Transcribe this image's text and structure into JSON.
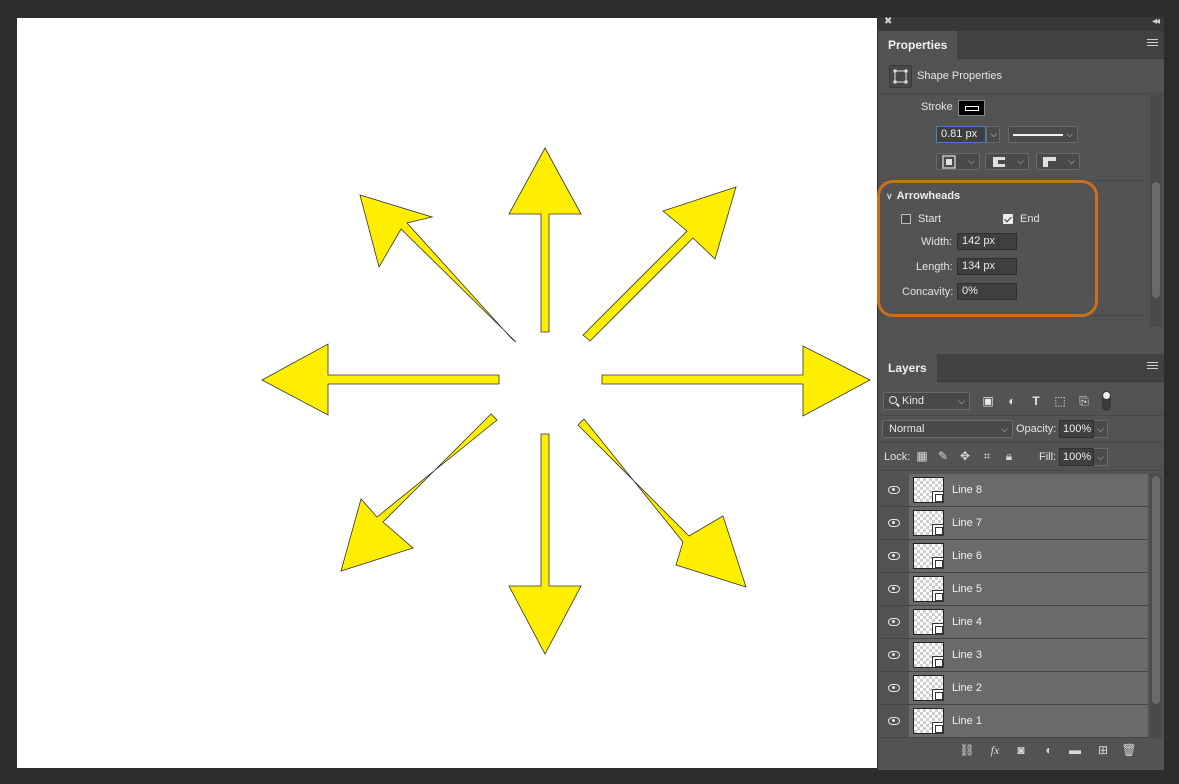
{
  "properties": {
    "tab_label": "Properties",
    "shape_props_label": "Shape Properties",
    "stroke_label": "Stroke",
    "stroke_width": "0.81 px",
    "arrowheads": {
      "section_title": "Arrowheads",
      "start_label": "Start",
      "start_checked": false,
      "end_label": "End",
      "end_checked": true,
      "width_label": "Width:",
      "width_value": "142 px",
      "length_label": "Length:",
      "length_value": "134 px",
      "concavity_label": "Concavity:",
      "concavity_value": "0%"
    }
  },
  "layers": {
    "tab_label": "Layers",
    "filter_kind": "Kind",
    "blend_mode": "Normal",
    "opacity_label": "Opacity:",
    "opacity_value": "100%",
    "lock_label": "Lock:",
    "fill_label": "Fill:",
    "fill_value": "100%",
    "items": [
      {
        "name": "Line 8"
      },
      {
        "name": "Line 7"
      },
      {
        "name": "Line 6"
      },
      {
        "name": "Line 5"
      },
      {
        "name": "Line 4"
      },
      {
        "name": "Line 3"
      },
      {
        "name": "Line 2"
      },
      {
        "name": "Line 1"
      }
    ]
  },
  "colors": {
    "arrow_fill": "#ffee00",
    "highlight": "#c8701a",
    "canvas": "#ffffff",
    "panel": "#535353"
  },
  "icons": {
    "bottom_bar": [
      "link-icon",
      "fx-icon",
      "mask-icon",
      "adjustment-icon",
      "folder-icon",
      "new-layer-icon",
      "trash-icon"
    ]
  }
}
